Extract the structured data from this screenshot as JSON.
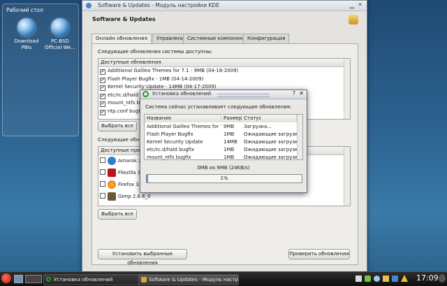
{
  "desktop": {
    "widget_title": "Рабочий стол",
    "icons": [
      {
        "label": "Download\nPBIs",
        "icon": "globe-icon"
      },
      {
        "label": "PC-BSD\nOfficial We...",
        "icon": "globe-icon"
      }
    ]
  },
  "main_window": {
    "title": "Software & Updates - Модуль настройки KDE",
    "heading": "Software & Updates",
    "tabs": [
      "Онлайн обновления",
      "Управление PBI",
      "Системные компоненты",
      "Конфигурация"
    ],
    "system_section_label": "Следующие обновления системы доступны:",
    "system_list_header": "Доступные обновления",
    "system_updates": [
      "Additional Galileo Themes for 7.1 - 9MB (04-16-2009)",
      "Flash Player Bugfix - 1MB (04-14-2009)",
      "Kernel Security Update - 14MB (04-17-2009)",
      "etc/rc.d/hald bugfix",
      "mount_ntfs bugfix",
      "ntp.conf bugfix"
    ],
    "select_all_1": "Выбрать все",
    "pbi_section_label": "Следующие обн",
    "pbi_list_header": "Доступные прогр",
    "pbi_updates": [
      {
        "name": "Amarok 2",
        "icon": "amarok-icon",
        "color": "#2f7fd0"
      },
      {
        "name": "Filezilla 3.",
        "icon": "filezilla-icon",
        "color": "#b8161b"
      },
      {
        "name": "Firefox 3.0",
        "icon": "firefox-icon",
        "color": "#e66a12"
      },
      {
        "name": "Gimp 2.6.6_0",
        "icon": "gimp-icon",
        "color": "#6b5a3a"
      }
    ],
    "select_all_2": "Выбрать все",
    "install_selected": "Установить выбранные обновления",
    "check_updates": "Проверить обновления"
  },
  "dialog": {
    "title": "Установка обновлений",
    "message": "Система сейчас устанавливает следующие обновления:",
    "columns": [
      "Название",
      "Размер",
      "Статус"
    ],
    "rows": [
      {
        "name": "Additional Galileo Themes for 7.1",
        "size": "9MB",
        "status": "Загрузка..."
      },
      {
        "name": "Flash Player Bugfix",
        "size": "1MB",
        "status": "Ожидающие загрузки"
      },
      {
        "name": "Kernel Security Update",
        "size": "14MB",
        "status": "Ожидающие загрузки"
      },
      {
        "name": "etc/rc.d/hald bugfix",
        "size": "1MB",
        "status": "Ожидающие загрузки"
      },
      {
        "name": "mount_ntfs bugfix",
        "size": "1MB",
        "status": "Ожидающие загрузки"
      }
    ],
    "transfer": "0MB из 9MB (24KB/s)",
    "progress_text": "1%",
    "progress_value": 0.01
  },
  "taskbar": {
    "tasks": [
      "Установка обновлений",
      "Software & Updates - Модуль настр..."
    ],
    "clock": "17:09"
  },
  "colors": {
    "accent": "#3c79c4",
    "desktop": "#2c6391"
  }
}
